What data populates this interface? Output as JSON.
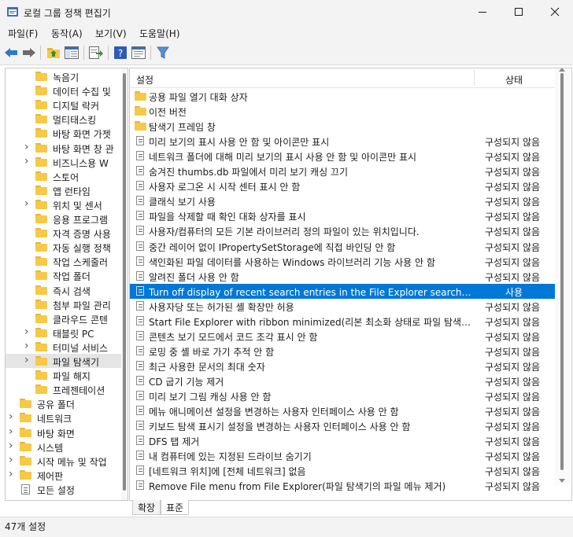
{
  "window": {
    "title": "로컬 그룹 정책 편집기",
    "icons": {
      "app": "policy-editor-icon",
      "minimize": "minimize-icon",
      "maximize": "maximize-icon",
      "close": "close-icon"
    }
  },
  "menu": [
    "파일(F)",
    "동작(A)",
    "보기(V)",
    "도움말(H)"
  ],
  "toolbar": [
    "back-arrow-icon",
    "forward-arrow-icon",
    "up-folder-icon",
    "show-hide-tree-icon",
    "export-list-icon",
    "help-icon",
    "properties-icon",
    "filter-icon"
  ],
  "tree": [
    {
      "label": "녹음기",
      "expand": false
    },
    {
      "label": "데이터 수집 및",
      "expand": false
    },
    {
      "label": "디지털 락커",
      "expand": false
    },
    {
      "label": "멀티태스킹",
      "expand": false
    },
    {
      "label": "바탕 화면 가젯",
      "expand": false
    },
    {
      "label": "바탕 화면 창 관",
      "expand": true
    },
    {
      "label": "비즈니스용 W",
      "expand": true
    },
    {
      "label": "스토어",
      "expand": false
    },
    {
      "label": "앱 런타임",
      "expand": false
    },
    {
      "label": "위치 및 센서",
      "expand": true
    },
    {
      "label": "응용 프로그램",
      "expand": false
    },
    {
      "label": "자격 증명 사용",
      "expand": false
    },
    {
      "label": "자동 실행 정책",
      "expand": false
    },
    {
      "label": "작업 스케줄러",
      "expand": false
    },
    {
      "label": "작업 폴더",
      "expand": false
    },
    {
      "label": "즉시 검색",
      "expand": false
    },
    {
      "label": "첨부 파일 관리",
      "expand": false
    },
    {
      "label": "클라우드 콘텐",
      "expand": false
    },
    {
      "label": "태블릿 PC",
      "expand": true
    },
    {
      "label": "터미널 서비스",
      "expand": true
    },
    {
      "label": "파일 탐색기",
      "expand": true,
      "selected": true
    },
    {
      "label": "파일 해지",
      "expand": false
    },
    {
      "label": "프레젠테이션",
      "expand": false
    },
    {
      "label": "공유 폴더",
      "expand": false
    },
    {
      "label": "네트워크",
      "expand": true
    },
    {
      "label": "바탕 화면",
      "expand": true
    },
    {
      "label": "시스템",
      "expand": true
    },
    {
      "label": "시작 메뉴 및 작업",
      "expand": true
    },
    {
      "label": "제어판",
      "expand": true
    },
    {
      "label": "모든 설정",
      "expand": false,
      "icon": "policy"
    }
  ],
  "list": {
    "col_setting": "설정",
    "col_state": "상태",
    "rows": [
      {
        "type": "folder",
        "name": "공용 파일 열기 대화 상자",
        "state": ""
      },
      {
        "type": "folder",
        "name": "이전 버전",
        "state": ""
      },
      {
        "type": "folder",
        "name": "탐색기 프레임 창",
        "state": ""
      },
      {
        "type": "policy",
        "name": "미리 보기의 표시 사용 안 함 및 아이콘만 표시",
        "state": "구성되지 않음"
      },
      {
        "type": "policy",
        "name": "네트워크 폴더에 대해 미리 보기의 표시 사용 안 함 및 아이콘만 표시",
        "state": "구성되지 않음"
      },
      {
        "type": "policy",
        "name": "숨겨진 thumbs.db 파일에서 미리 보기 캐싱 끄기",
        "state": "구성되지 않음"
      },
      {
        "type": "policy",
        "name": "사용자 로그온 시 시작 센터 표시 안 함",
        "state": "구성되지 않음"
      },
      {
        "type": "policy",
        "name": "클래식 보기 사용",
        "state": "구성되지 않음"
      },
      {
        "type": "policy",
        "name": "파일을 삭제할 때 확인 대화 상자를 표시",
        "state": "구성되지 않음"
      },
      {
        "type": "policy",
        "name": "사용자/컴퓨터의 모든 기본 라이브러리 정의 파일이 있는 위치입니다.",
        "state": "구성되지 않음"
      },
      {
        "type": "policy",
        "name": "중간 레이어 없이 IPropertySetStorage에 직접 바인딩 안 함",
        "state": "구성되지 않음"
      },
      {
        "type": "policy",
        "name": "색인화된 파일 데이터를 사용하는 Windows 라이브러리 기능 사용 안 함",
        "state": "구성되지 않음"
      },
      {
        "type": "policy",
        "name": "알려진 폴더 사용 안 함",
        "state": "구성되지 않음"
      },
      {
        "type": "policy",
        "name": "Turn off display of recent search entries in the File Explorer search box(파...",
        "state": "사용",
        "selected": true
      },
      {
        "type": "policy",
        "name": "사용자당 또는 허가된 셸 확장만 허용",
        "state": "구성되지 않음"
      },
      {
        "type": "policy",
        "name": "Start File Explorer with ribbon minimized(리본 최소화 상태로 파일 탐색기 ...",
        "state": "구성되지 않음"
      },
      {
        "type": "policy",
        "name": "콘텐츠 보기 모드에서 코드 조각 표시 안 함",
        "state": "구성되지 않음"
      },
      {
        "type": "policy",
        "name": "로밍 중 셸 바로 가기 추적 안 함",
        "state": "구성되지 않음"
      },
      {
        "type": "policy",
        "name": "최근 사용한 문서의 최대 숫자",
        "state": "구성되지 않음"
      },
      {
        "type": "policy",
        "name": "CD 굽기 기능 제거",
        "state": "구성되지 않음"
      },
      {
        "type": "policy",
        "name": "미리 보기 그림 캐싱 사용 안 함",
        "state": "구성되지 않음"
      },
      {
        "type": "policy",
        "name": "메뉴 애니메이션 설정을 변경하는 사용자 인터페이스 사용 안 함",
        "state": "구성되지 않음"
      },
      {
        "type": "policy",
        "name": "키보드 탐색 표시기 설정을 변경하는 사용자 인터페이스 사용 안 함",
        "state": "구성되지 않음"
      },
      {
        "type": "policy",
        "name": "DFS 탭 제거",
        "state": "구성되지 않음"
      },
      {
        "type": "policy",
        "name": "내 컴퓨터에 있는 지정된 드라이브 숨기기",
        "state": "구성되지 않음"
      },
      {
        "type": "policy",
        "name": "[네트워크 위치]에 [전체 네트워크] 없음",
        "state": "구성되지 않음"
      },
      {
        "type": "policy",
        "name": "Remove File menu from File Explorer(파일 탐색기의 파일 메뉴 제거)",
        "state": "구성되지 않음"
      }
    ]
  },
  "tabs": [
    "확장",
    "표준"
  ],
  "status": "47개 설정",
  "colors": {
    "selection": "#0078d7",
    "folder": "#f6c946",
    "chrome": "#f3f3f3"
  }
}
